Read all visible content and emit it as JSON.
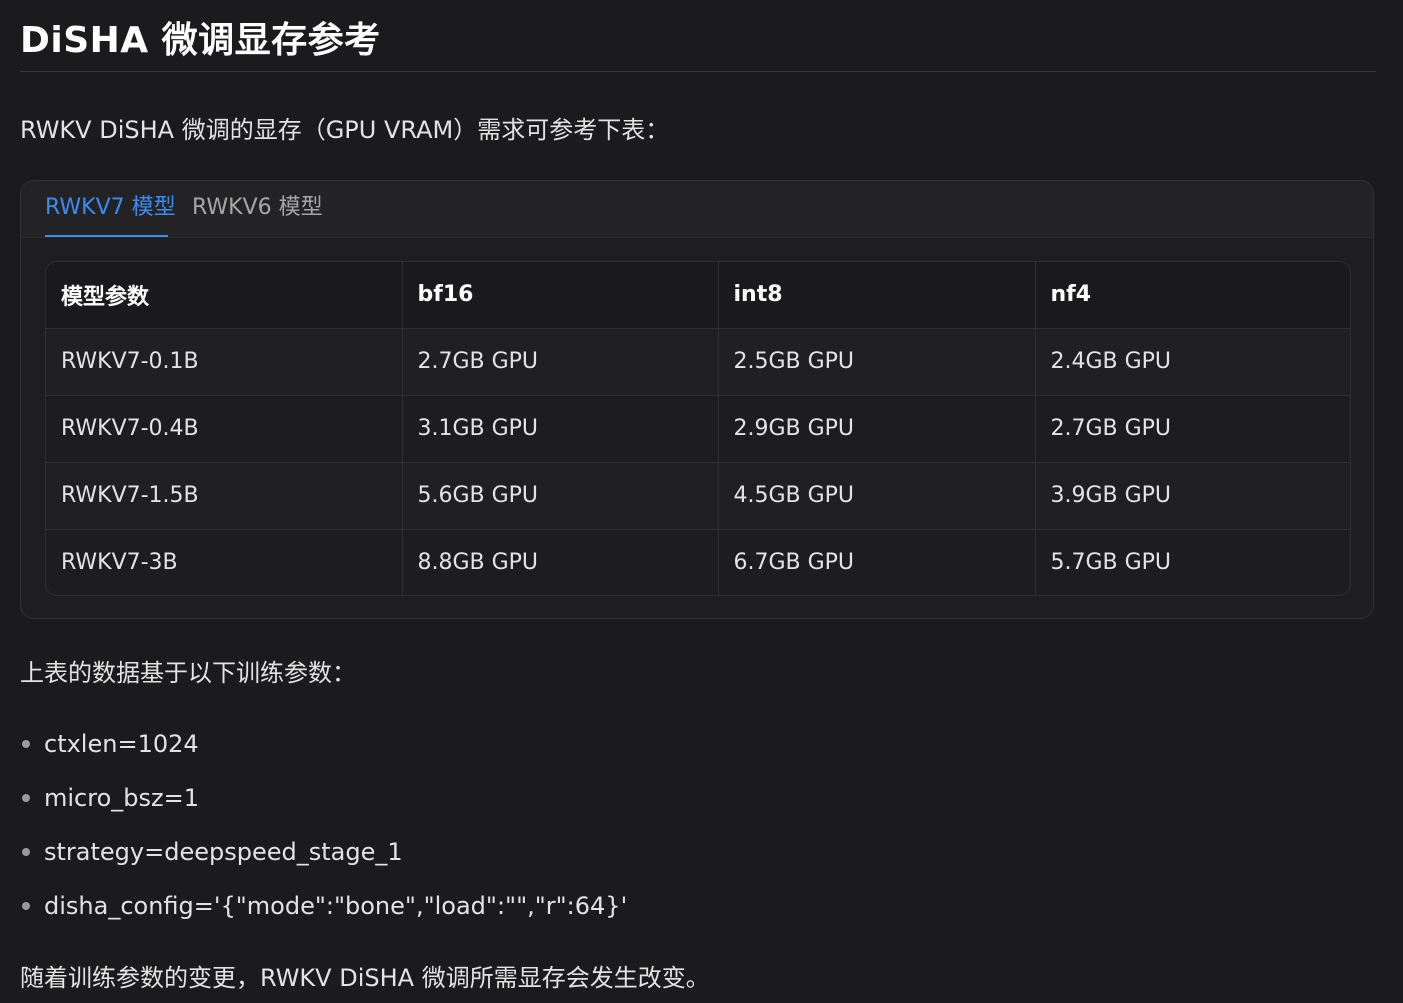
{
  "title": "DiSHA 微调显存参考",
  "intro": "RWKV DiSHA 微调的显存（GPU VRAM）需求可参考下表：",
  "tabs": [
    {
      "label": "RWKV7 模型",
      "active": true
    },
    {
      "label": "RWKV6 模型",
      "active": false
    }
  ],
  "table": {
    "headers": [
      "模型参数",
      "bf16",
      "int8",
      "nf4"
    ],
    "rows": [
      [
        "RWKV7-0.1B",
        "2.7GB GPU",
        "2.5GB GPU",
        "2.4GB GPU"
      ],
      [
        "RWKV7-0.4B",
        "3.1GB GPU",
        "2.9GB GPU",
        "2.7GB GPU"
      ],
      [
        "RWKV7-1.5B",
        "5.6GB GPU",
        "4.5GB GPU",
        "3.9GB GPU"
      ],
      [
        "RWKV7-3B",
        "8.8GB GPU",
        "6.7GB GPU",
        "5.7GB GPU"
      ]
    ]
  },
  "basis_text": "上表的数据基于以下训练参数：",
  "params": [
    "ctxlen=1024",
    "micro_bsz=1",
    "strategy=deepspeed_stage_1",
    "disha_config='{\"mode\":\"bone\",\"load\":\"\",\"r\":64}'"
  ],
  "outro": "随着训练参数的变更，RWKV DiSHA 微调所需显存会发生改变。",
  "colors": {
    "background": "#1b1b1d",
    "accent": "#3a8cf0",
    "text": "#e3e3e3"
  }
}
